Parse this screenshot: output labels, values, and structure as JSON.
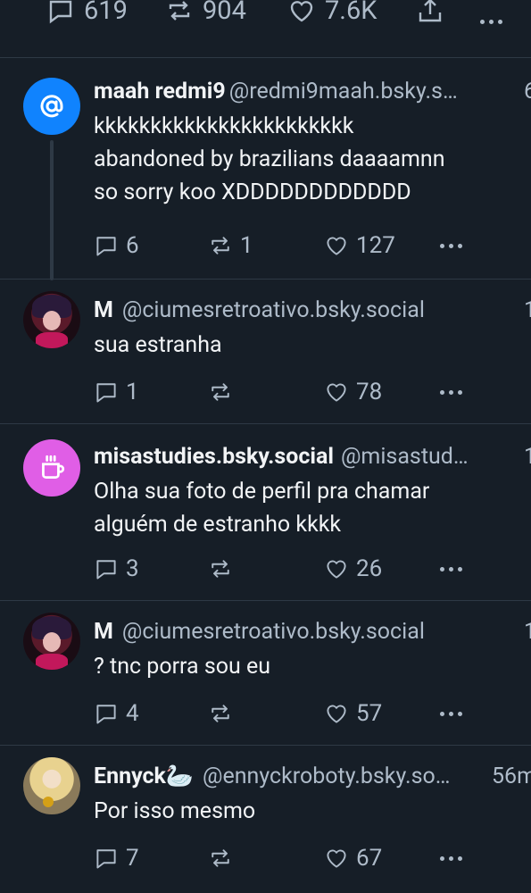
{
  "top_post": {
    "reply_count": "619",
    "repost_count": "904",
    "like_count": "7.6K"
  },
  "posts": [
    {
      "name": "maah redmi9",
      "handle": "@redmi9maah.bsky.s…",
      "time": "6",
      "text": "kkkkkkkkkkkkkkkkkkkkkkk\nabandoned by brazilians daaaamnn\nso sorry koo XDDDDDDDDDDDD",
      "replies": "6",
      "reposts": "1",
      "likes": "127",
      "avatar_icon": "at-sign-icon",
      "avatar_color": "#1083fe"
    },
    {
      "name": "M",
      "handle": "@ciumesretroativo.bsky.social",
      "time": "1",
      "text": "sua estranha",
      "replies": "1",
      "reposts": "",
      "likes": "78"
    },
    {
      "name": "misastudies.bsky.social",
      "handle": "@misastud…",
      "time": "1",
      "text": "Olha sua foto de perfil pra chamar\nalguém de estranho kkkk",
      "replies": "3",
      "reposts": "",
      "likes": "26",
      "avatar_icon": "coffee-cup-icon",
      "avatar_color": "#e05ee6"
    },
    {
      "name": "M",
      "handle": "@ciumesretroativo.bsky.social",
      "time": "1",
      "text": "? tnc porra sou eu",
      "replies": "4",
      "reposts": "",
      "likes": "57"
    },
    {
      "name": "Ennyck🦢",
      "handle": "@ennyckroboty.bsky.so…",
      "time": "56m",
      "text": "Por isso mesmo",
      "replies": "7",
      "reposts": "",
      "likes": "67"
    }
  ],
  "colors": {
    "background": "#161e27",
    "divider": "#2e3945",
    "text_primary": "#f1f3f5",
    "text_secondary": "#aebbc9"
  }
}
